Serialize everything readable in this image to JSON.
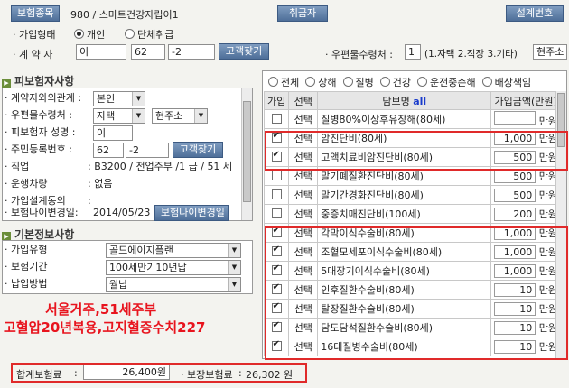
{
  "top": {
    "product_label": "보험종목",
    "product_value": "980 / 스마트건강자립이1",
    "issue_button": "취급자",
    "design_no_label": "설계번호",
    "enroll_type_label": "· 가입형태",
    "enroll_options": [
      "개인",
      "단체취급"
    ],
    "enroll_selected": 0,
    "contractor_label": "· 계 약 자",
    "contractor_name": "이",
    "contractor_id1": "62",
    "contractor_id2": "-2",
    "find_customer": "고객찾기",
    "mail_label": "· 우편물수령처 :",
    "mail_value": "1",
    "mail_hint": "(1.자택 2.직장 3.기타)",
    "mail_extra": "현주소"
  },
  "insured": {
    "title": "피보험자사항",
    "rows": [
      {
        "label": "· 계약자와의관계 :",
        "value": "본인"
      },
      {
        "label": "· 우편물수령처 :",
        "value": "자택",
        "value2": "현주소"
      },
      {
        "label": "· 피보험자 성명 :",
        "value": "이"
      },
      {
        "label": "· 주민등록번호 :",
        "value": "62",
        "value2": "-2",
        "button": "고객찾기"
      },
      {
        "label": "· 직업",
        "value": ": B3200 / 전업주부 /1 급 / 51 세"
      },
      {
        "label": "· 운행차량",
        "value": ": 없음"
      },
      {
        "label": "· 가입설계동의",
        "value": ":"
      },
      {
        "label": "· 보험나이변경일:",
        "value": "2014/05/23",
        "button": "보험나이변경일"
      }
    ]
  },
  "basic": {
    "title": "기본정보사항",
    "rows": [
      {
        "label": "· 가입유형",
        "value": "골드에이지플랜"
      },
      {
        "label": "· 보험기간",
        "value": "100세만기10년납"
      },
      {
        "label": "· 납입방법",
        "value": "월납"
      }
    ],
    "note_line1": "서울거주,51세주부",
    "note_line2": "고혈압20년복용,고지혈증수치227"
  },
  "coverage": {
    "filters": [
      "전체",
      "상해",
      "질병",
      "건강",
      "운전중손해",
      "배상책임"
    ],
    "filter_selected": -1,
    "headers": {
      "join": "가입",
      "select": "선택",
      "name": "담보명",
      "all": "all",
      "amount": "가입금액(만원)"
    },
    "select_label": "선택",
    "unit": "만원",
    "rows": [
      {
        "checked": false,
        "name": "질병80%이상후유장해(80세)",
        "amount": ""
      },
      {
        "checked": true,
        "name": "암진단비(80세)",
        "amount": "1,000"
      },
      {
        "checked": true,
        "name": "고액치료비암진단비(80세)",
        "amount": "500"
      },
      {
        "checked": false,
        "name": "말기폐질환진단비(80세)",
        "amount": "500"
      },
      {
        "checked": false,
        "name": "말기간경화진단비(80세)",
        "amount": "500"
      },
      {
        "checked": false,
        "name": "중증치매진단비(100세)",
        "amount": "200"
      },
      {
        "checked": true,
        "name": "각막이식수술비(80세)",
        "amount": "1,000"
      },
      {
        "checked": true,
        "name": "조혈모세포이식수술비(80세)",
        "amount": "1,000"
      },
      {
        "checked": true,
        "name": "5대장기이식수술비(80세)",
        "amount": "1,000"
      },
      {
        "checked": true,
        "name": "인후질환수술비(80세)",
        "amount": "10"
      },
      {
        "checked": true,
        "name": "탈장질환수술비(80세)",
        "amount": "10"
      },
      {
        "checked": true,
        "name": "담도담석질환수술비(80세)",
        "amount": "10"
      },
      {
        "checked": true,
        "name": "16대질병수술비(80세)",
        "amount": "10"
      }
    ]
  },
  "footer": {
    "total_label": "합계보험료",
    "total_value": "26,400원",
    "protect_label": "· 보장보험료",
    "protect_value": "26,302 원"
  },
  "colors": {
    "accent_blue": "#4e6f99",
    "highlight_red": "#e02a2a",
    "note_red": "#e8141e",
    "section_green": "#6b8e3a"
  }
}
